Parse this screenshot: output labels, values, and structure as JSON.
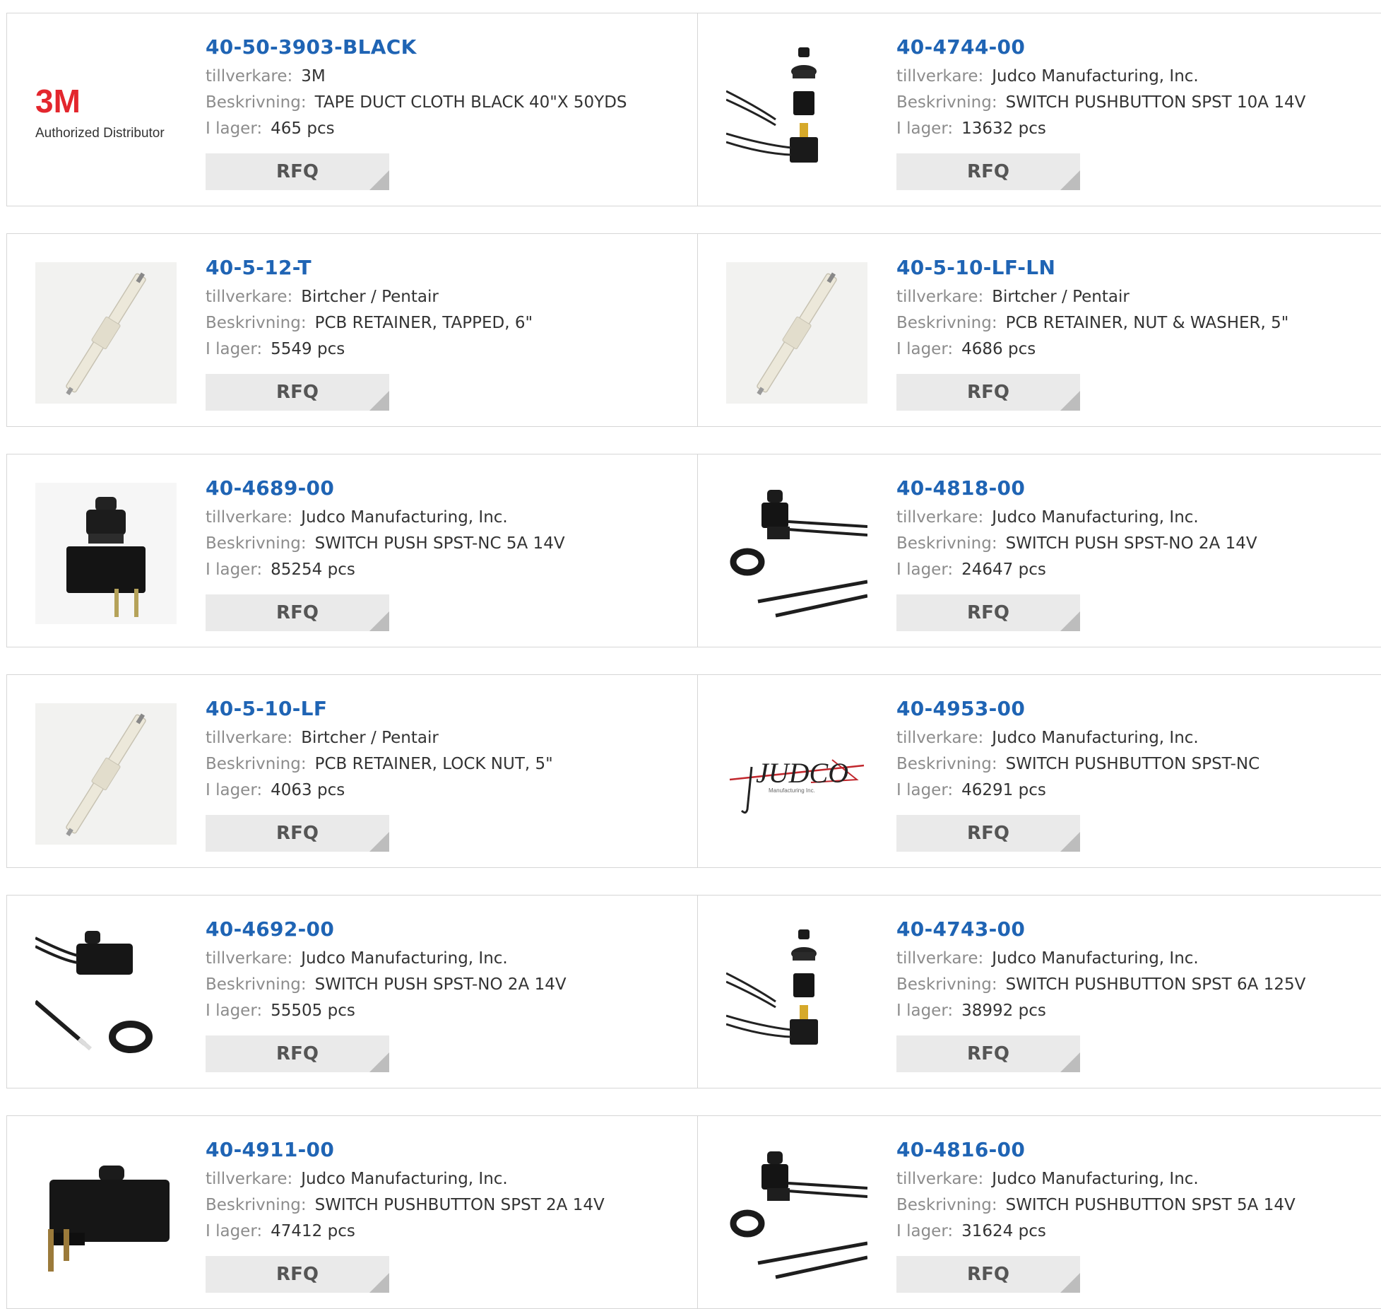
{
  "labels": {
    "manufacturer": "tillverkare:",
    "description": "Beskrivning:",
    "stock": "I lager:",
    "rfq": "RFQ"
  },
  "logos": {
    "threem_mark": "3M",
    "threem_tagline": "Authorized Distributor",
    "judco_mark": "JUDCO",
    "judco_sub": "Manufacturing Inc."
  },
  "products": [
    {
      "part": "40-50-3903-BLACK",
      "manufacturer": "3M",
      "description": "TAPE DUCT CLOTH BLACK 40\"X 50YDS",
      "stock": "465 pcs",
      "image": "3m-logo-icon"
    },
    {
      "part": "40-4744-00",
      "manufacturer": "Judco Manufacturing, Inc.",
      "description": "SWITCH PUSHBUTTON SPST 10A 14V",
      "stock": "13632 pcs",
      "image": "pushbutton-exploded-icon"
    },
    {
      "part": "40-5-12-T",
      "manufacturer": "Birtcher / Pentair",
      "description": "PCB RETAINER, TAPPED, 6\"",
      "stock": "5549 pcs",
      "image": "pcb-retainer-icon"
    },
    {
      "part": "40-5-10-LF-LN",
      "manufacturer": "Birtcher / Pentair",
      "description": "PCB RETAINER, NUT & WASHER, 5\"",
      "stock": "4686 pcs",
      "image": "pcb-retainer-icon"
    },
    {
      "part": "40-4689-00",
      "manufacturer": "Judco Manufacturing, Inc.",
      "description": "SWITCH PUSH SPST-NC 5A 14V",
      "stock": "85254 pcs",
      "image": "panel-switch-icon"
    },
    {
      "part": "40-4818-00",
      "manufacturer": "Judco Manufacturing, Inc.",
      "description": "SWITCH PUSH SPST-NO 2A 14V",
      "stock": "24647 pcs",
      "image": "wired-switch-icon"
    },
    {
      "part": "40-5-10-LF",
      "manufacturer": "Birtcher / Pentair",
      "description": "PCB RETAINER, LOCK NUT, 5\"",
      "stock": "4063 pcs",
      "image": "pcb-retainer-icon"
    },
    {
      "part": "40-4953-00",
      "manufacturer": "Judco Manufacturing, Inc.",
      "description": "SWITCH PUSHBUTTON SPST-NC",
      "stock": "46291 pcs",
      "image": "judco-logo-icon"
    },
    {
      "part": "40-4692-00",
      "manufacturer": "Judco Manufacturing, Inc.",
      "description": "SWITCH PUSH SPST-NO 2A 14V",
      "stock": "55505 pcs",
      "image": "wired-switch-ring-icon"
    },
    {
      "part": "40-4743-00",
      "manufacturer": "Judco Manufacturing, Inc.",
      "description": "SWITCH PUSHBUTTON SPST 6A 125V",
      "stock": "38992 pcs",
      "image": "pushbutton-exploded-icon"
    },
    {
      "part": "40-4911-00",
      "manufacturer": "Judco Manufacturing, Inc.",
      "description": "SWITCH PUSHBUTTON SPST 2A 14V",
      "stock": "47412 pcs",
      "image": "pcb-pushbutton-icon"
    },
    {
      "part": "40-4816-00",
      "manufacturer": "Judco Manufacturing, Inc.",
      "description": "SWITCH PUSHBUTTON SPST 5A 14V",
      "stock": "31624 pcs",
      "image": "wired-switch-icon"
    }
  ],
  "colors": {
    "link": "#1f64b4",
    "label": "#8c8c8c",
    "value": "#333333",
    "border": "#d6d6d6",
    "button_bg": "#eaeaea",
    "logo_red": "#e3262d"
  }
}
